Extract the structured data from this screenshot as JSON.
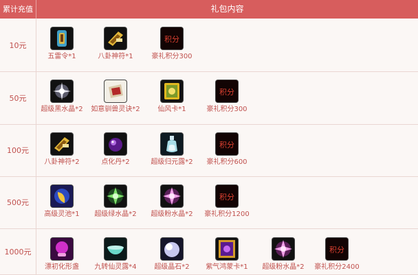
{
  "header": {
    "col1": "累计充值",
    "col2": "礼包内容"
  },
  "rows": [
    {
      "amount": "10元",
      "items": [
        {
          "label": "五雷令*1",
          "icon": "thunder-token-icon"
        },
        {
          "label": "八卦神符*1",
          "icon": "bagua-talisman-icon"
        },
        {
          "label": "豪礼积分300",
          "icon": "points-icon"
        }
      ]
    },
    {
      "amount": "50元",
      "items": [
        {
          "label": "超级黑水晶*2",
          "icon": "black-crystal-icon"
        },
        {
          "label": "如意驯兽灵诀*2",
          "icon": "beast-scroll-icon"
        },
        {
          "label": "仙风卡*1",
          "icon": "immortal-card-icon"
        },
        {
          "label": "豪礼积分300",
          "icon": "points-icon"
        }
      ]
    },
    {
      "amount": "100元",
      "items": [
        {
          "label": "八卦神符*2",
          "icon": "bagua-talisman-icon"
        },
        {
          "label": "点化丹*2",
          "icon": "purple-pill-icon"
        },
        {
          "label": "超级归元露*2",
          "icon": "potion-bottle-icon"
        },
        {
          "label": "豪礼积分600",
          "icon": "points-icon"
        }
      ]
    },
    {
      "amount": "500元",
      "items": [
        {
          "label": "高级灵池*1",
          "icon": "moon-pool-icon"
        },
        {
          "label": "超级绿水晶*2",
          "icon": "green-crystal-icon"
        },
        {
          "label": "超级粉水晶*2",
          "icon": "pink-crystal-icon"
        },
        {
          "label": "豪礼积分1200",
          "icon": "points-icon"
        }
      ]
    },
    {
      "amount": "1000元",
      "items": [
        {
          "label": "漂初化形盏",
          "icon": "transform-lamp-icon"
        },
        {
          "label": "九转仙灵露*4",
          "icon": "jade-bowl-icon"
        },
        {
          "label": "超级晶石*2",
          "icon": "crystal-stone-icon"
        },
        {
          "label": "紫气鸿蒙卡*1",
          "icon": "purple-card-icon"
        },
        {
          "label": "超级粉水晶*2",
          "icon": "pink-crystal-icon"
        },
        {
          "label": "豪礼积分2400",
          "icon": "points-icon"
        }
      ]
    }
  ],
  "points_glyph": "积分"
}
